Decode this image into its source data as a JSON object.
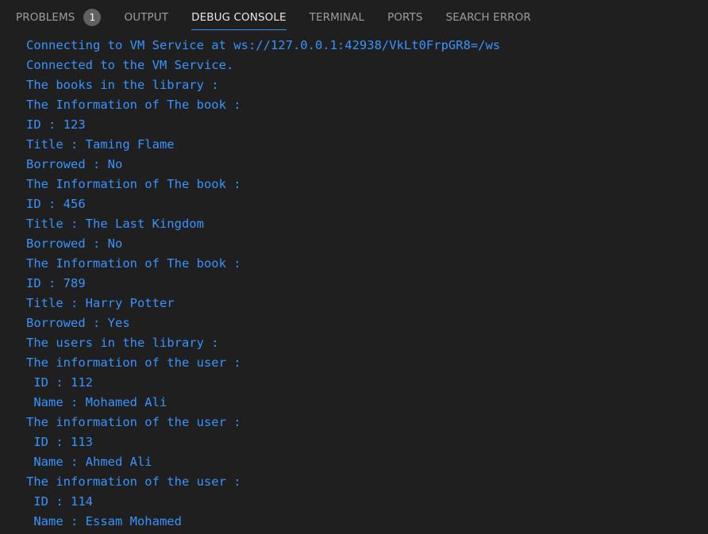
{
  "tabs": [
    {
      "label": "PROBLEMS",
      "badge": "1"
    },
    {
      "label": "OUTPUT"
    },
    {
      "label": "DEBUG CONSOLE",
      "active": true
    },
    {
      "label": "TERMINAL"
    },
    {
      "label": "PORTS"
    },
    {
      "label": "SEARCH ERROR"
    }
  ],
  "colors": {
    "background": "#1f1f1f",
    "output_text": "#3794ff",
    "active_tab_underline": "#3794ff",
    "badge_bg": "#616161"
  },
  "console_lines": [
    "Connecting to VM Service at ws://127.0.0.1:42938/VkLt0FrpGR8=/ws",
    "Connected to the VM Service.",
    "The books in the library :",
    "The Information of The book :",
    "ID : 123",
    "Title : Taming Flame",
    "Borrowed : No",
    "The Information of The book :",
    "ID : 456",
    "Title : The Last Kingdom",
    "Borrowed : No",
    "The Information of The book :",
    "ID : 789",
    "Title : Harry Potter",
    "Borrowed : Yes",
    "The users in the library :",
    "The information of the user :",
    " ID : 112",
    " Name : Mohamed Ali",
    "The information of the user :",
    " ID : 113",
    " Name : Ahmed Ali",
    "The information of the user :",
    " ID : 114",
    " Name : Essam Mohamed"
  ]
}
